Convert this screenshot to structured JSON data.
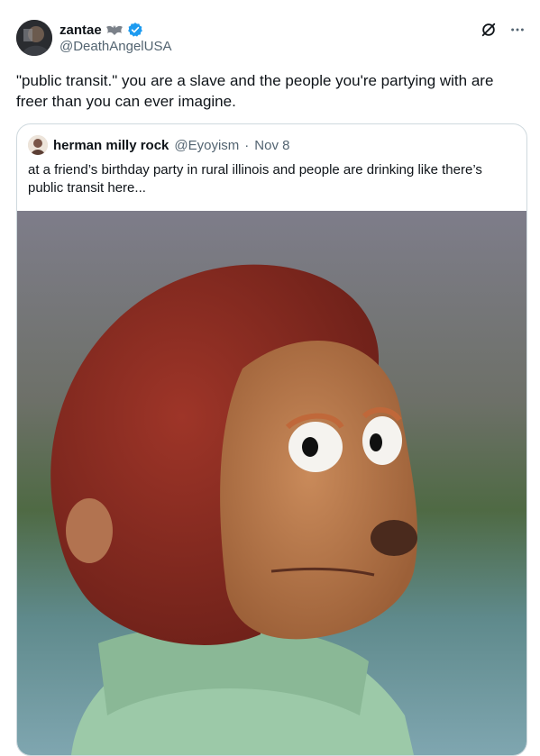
{
  "tweet": {
    "display_name": "zantae",
    "name_emoji": "bat-emoji",
    "handle": "@DeathAngelUSA",
    "text": "\"public transit.\" you are a slave and the people you're partying with are freer than you can ever imagine."
  },
  "icons": {
    "grok": "grok-icon",
    "more": "more-icon",
    "verified": "verified-badge-icon"
  },
  "quoted": {
    "display_name": "herman milly rock",
    "handle": "@Eyoyism",
    "separator": "·",
    "date": "Nov 8",
    "text": "at a friend’s birthday party in rural illinois and people are drinking like there’s public transit here..."
  },
  "colors": {
    "verified": "#1d9bf0",
    "secondary_text": "#536471",
    "border": "#cfd9de"
  }
}
